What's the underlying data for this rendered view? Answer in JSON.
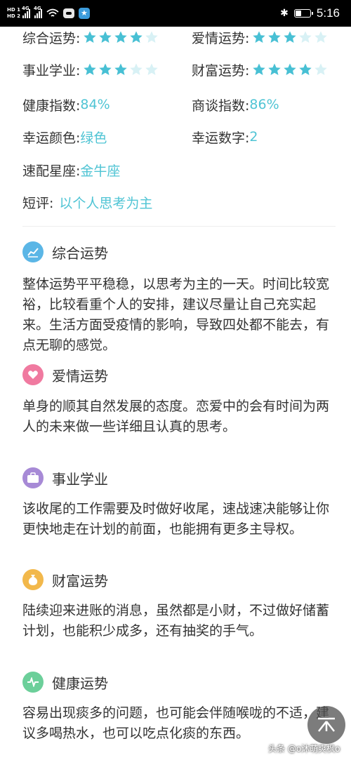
{
  "status_bar": {
    "sim1": "HD 1",
    "sim2": "HD 2",
    "network1": "4G",
    "network2": "4G",
    "time": "5:16"
  },
  "summary": {
    "rows": [
      {
        "label": "综合运势:",
        "stars": 4,
        "max": 5
      },
      {
        "label": "爱情运势:",
        "stars": 3,
        "max": 5
      },
      {
        "label": "事业学业:",
        "stars": 3,
        "max": 5
      },
      {
        "label": "财富运势:",
        "stars": 4,
        "max": 5
      }
    ],
    "health_label": "健康指数:",
    "health_value": "84%",
    "negotiation_label": "商谈指数:",
    "negotiation_value": "86%",
    "lucky_color_label": "幸运颜色:",
    "lucky_color_value": "绿色",
    "lucky_number_label": "幸运数字:",
    "lucky_number_value": "2",
    "match_label": "速配星座:",
    "match_value": "金牛座",
    "comment_label": "短评:",
    "comment_value": "以个人思考为主"
  },
  "sections": [
    {
      "title": "综合运势",
      "icon": "chart-icon",
      "color": "#5bb6e6",
      "text": "整体运势平平稳稳，以思考为主的一天。时间比较宽裕，比较看重个人的安排，建议尽量让自己充实起来。生活方面受疫情的影响，导致四处都不能去，有点无聊的感觉。"
    },
    {
      "title": "爱情运势",
      "icon": "heart-icon",
      "color": "#f07aa0",
      "text": "单身的顺其自然发展的态度。恋爱中的会有时间为两人的未来做一些详细且认真的思考。"
    },
    {
      "title": "事业学业",
      "icon": "briefcase-icon",
      "color": "#a78ad6",
      "text": "该收尾的工作需要及时做好收尾，速战速决能够让你更快地走在计划的前面，也能拥有更多主导权。"
    },
    {
      "title": "财富运势",
      "icon": "money-bag-icon",
      "color": "#f2b84b",
      "text": "陆续迎来进账的消息，虽然都是小财，不过做好储蓄计划，也能积少成多，还有抽奖的手气。"
    },
    {
      "title": "健康运势",
      "icon": "pulse-icon",
      "color": "#6ccf9a",
      "text": "容易出现痰多的问题，也可能会伴随喉咙的不适，建议多喝热水，也可以吃点化痰的东西。"
    }
  ],
  "watermark": "头条 @o沐萌爽枫o",
  "colors": {
    "accent": "#4fc4d4",
    "star_on": "#48c0d4",
    "star_off": "#d8f1f5"
  }
}
